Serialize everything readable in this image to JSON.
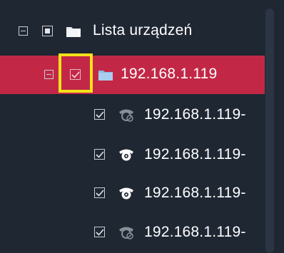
{
  "tree": {
    "root": {
      "label": "Lista urządzeń",
      "expanded": true,
      "check_state": "partial",
      "icon": "folder-icon"
    },
    "group": {
      "label": "192.168.1.119",
      "expanded": true,
      "checked": true,
      "selected": true,
      "icon": "folder-icon"
    },
    "cameras": [
      {
        "label": "192.168.1.119-",
        "checked": true,
        "icon": "camera-offline-icon"
      },
      {
        "label": "192.168.1.119-",
        "checked": true,
        "icon": "camera-online-icon"
      },
      {
        "label": "192.168.1.119-",
        "checked": true,
        "icon": "camera-online-icon"
      },
      {
        "label": "192.168.1.119-",
        "checked": true,
        "icon": "camera-offline-icon"
      }
    ]
  },
  "colors": {
    "background": "#1f2733",
    "selected_row": "#c22846",
    "highlight_box": "#f2e21a",
    "text": "#ffffff"
  }
}
